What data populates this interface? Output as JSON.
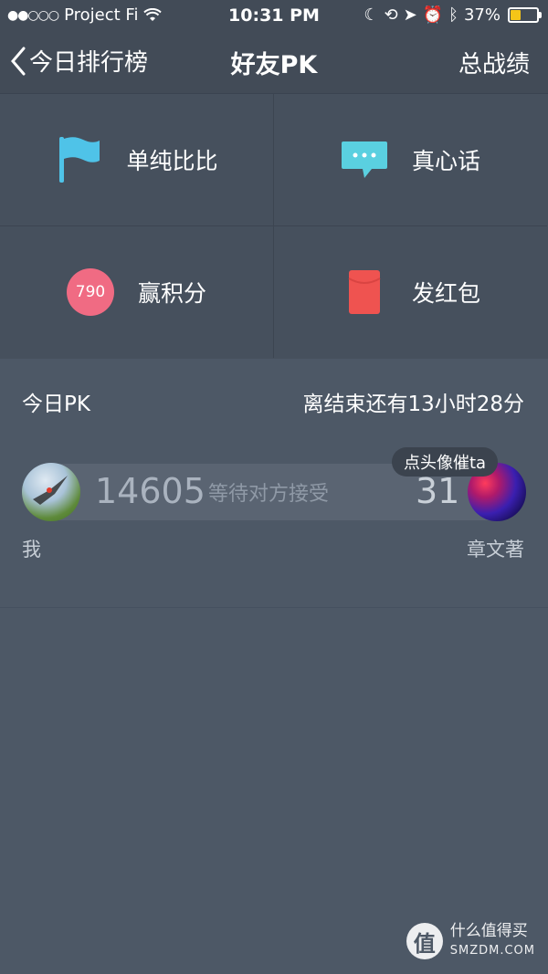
{
  "status_bar": {
    "carrier": "Project Fi",
    "time": "10:31 PM",
    "battery": "37%",
    "battery_level": 0.37,
    "signal_dots": "●●○○○"
  },
  "nav": {
    "back_label": "今日排行榜",
    "title": "好友PK",
    "right_label": "总战绩"
  },
  "modes": [
    {
      "label": "单纯比比",
      "icon": "flag-icon"
    },
    {
      "label": "真心话",
      "icon": "chat-bubble-icon"
    },
    {
      "label": "赢积分",
      "icon": "points-circle-icon",
      "badge": "790"
    },
    {
      "label": "发红包",
      "icon": "red-envelope-icon"
    }
  ],
  "section": {
    "title": "今日PK",
    "countdown": "离结束还有13小时28分"
  },
  "pk": {
    "my_score": "14605",
    "status": "等待对方接受",
    "opponent_score": "31",
    "nudge_label": "点头像催ta",
    "my_name": "我",
    "opponent_name": "章文著"
  },
  "watermark": {
    "glyph": "值",
    "line1": "什么值得买",
    "line2": "SMZDM.COM"
  },
  "colors": {
    "background": "#4d5866",
    "flag": "#4fc3e8",
    "chat": "#5ad0e0",
    "points": "#f06b83",
    "red_envelope": "#ef5350"
  }
}
